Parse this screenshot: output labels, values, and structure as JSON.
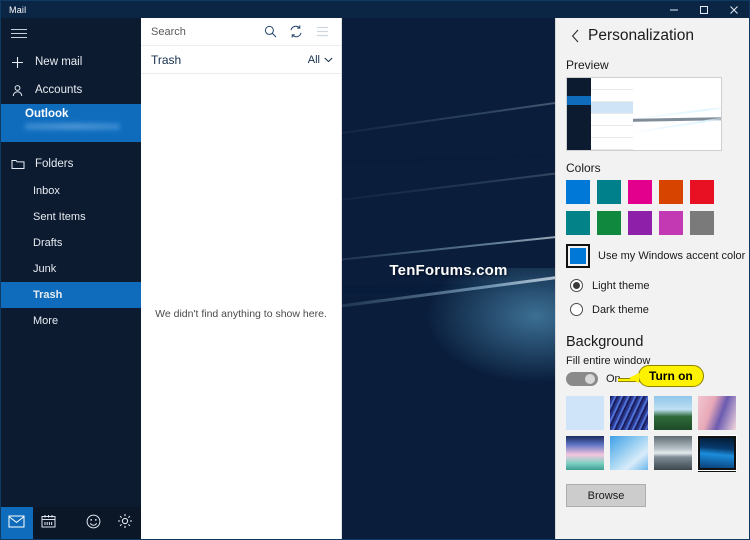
{
  "window": {
    "title": "Mail",
    "minimize_label": "Minimize",
    "maximize_label": "Maximize",
    "close_label": "Close"
  },
  "nav": {
    "menu_label": "Menu",
    "new_mail": "New mail",
    "accounts": "Accounts",
    "account_name": "Outlook",
    "folders_label": "Folders",
    "folders": [
      {
        "label": "Inbox",
        "selected": false
      },
      {
        "label": "Sent Items",
        "selected": false
      },
      {
        "label": "Drafts",
        "selected": false
      },
      {
        "label": "Junk",
        "selected": false
      },
      {
        "label": "Trash",
        "selected": true
      },
      {
        "label": "More",
        "selected": false
      }
    ],
    "taskbar": [
      {
        "name": "mail",
        "selected": true
      },
      {
        "name": "calendar",
        "selected": false
      },
      {
        "name": "feedback",
        "selected": false
      },
      {
        "name": "settings",
        "selected": false
      }
    ]
  },
  "list": {
    "search_placeholder": "Search",
    "search_icon": "search-icon",
    "sync_icon": "sync-icon",
    "menu_icon": "list-menu-icon",
    "folder_name": "Trash",
    "filter_label": "All",
    "filter_chevron": "chevron-down-icon",
    "empty_message": "We didn't find anything to show here."
  },
  "reading": {
    "watermark": "TenForums.com"
  },
  "panel": {
    "back_icon": "back-chevron-icon",
    "title": "Personalization",
    "preview_label": "Preview",
    "colors_label": "Colors",
    "colors": [
      "#0078d7",
      "#00808a",
      "#e3008c",
      "#d64400",
      "#e81123",
      "#038387",
      "#10893e",
      "#8e1fa8",
      "#c239b3",
      "#7a7a7a"
    ],
    "accent_color": "#0078d7",
    "accent_label": "Use my Windows accent color",
    "themes": [
      {
        "label": "Light theme",
        "selected": true
      },
      {
        "label": "Dark theme",
        "selected": false
      }
    ],
    "background_label": "Background",
    "fill_window_label": "Fill entire window",
    "fill_window_state": "On",
    "callout_text": "Turn on",
    "callout_color": "#fff200",
    "backgrounds": [
      {
        "name": "plain-light-blue",
        "selected": false
      },
      {
        "name": "blue-streaks",
        "selected": false
      },
      {
        "name": "mountain-lake",
        "selected": false
      },
      {
        "name": "pink-ribbon",
        "selected": false
      },
      {
        "name": "pastel-waves",
        "selected": false
      },
      {
        "name": "blue-crystal",
        "selected": false
      },
      {
        "name": "grey-shoreline",
        "selected": false
      },
      {
        "name": "windows-hero",
        "selected": true
      }
    ],
    "browse_label": "Browse"
  }
}
